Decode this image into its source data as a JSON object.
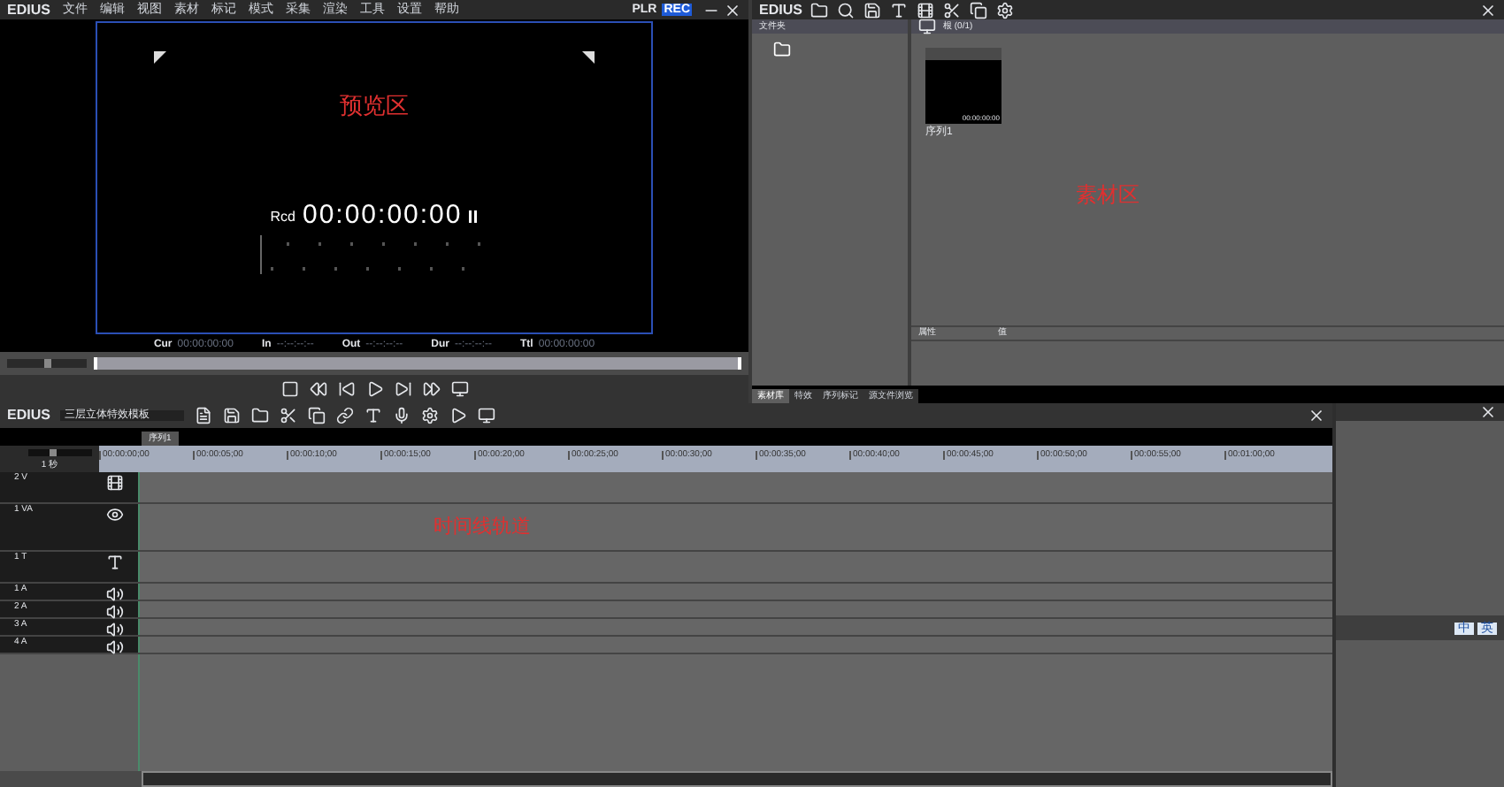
{
  "player": {
    "app_name": "EDIUS",
    "menu": [
      "文件",
      "编辑",
      "视图",
      "素材",
      "标记",
      "模式",
      "采集",
      "渲染",
      "工具",
      "设置",
      "帮助"
    ],
    "modes": [
      {
        "label": "PLR",
        "selected": false
      },
      {
        "label": "REC",
        "selected": true
      }
    ],
    "annotation": "预览区",
    "zoom": {
      "level": 0.5
    },
    "timecode_label": "Rcd",
    "timecode": "00:00:00:00",
    "readouts": [
      {
        "label": "Cur",
        "value": "00:00:00:00"
      },
      {
        "label": "In",
        "value": "--:--:--:--"
      },
      {
        "label": "Out",
        "value": "--:--:--:--"
      },
      {
        "label": "Dur",
        "value": "--:--:--:--"
      },
      {
        "label": "Ttl",
        "value": "00:00:00:00"
      }
    ]
  },
  "bin": {
    "app_name": "EDIUS",
    "folder_header": "文件夹",
    "clip_header": "根 (0/1)",
    "clip": {
      "timecode": "00:00:00:00",
      "name": "序列1"
    },
    "annotation": "素材区",
    "properties_columns": [
      "属性",
      "值"
    ],
    "tabs": [
      {
        "label": "素材库",
        "selected": true
      },
      {
        "label": "特效",
        "selected": false
      },
      {
        "label": "序列标记",
        "selected": false
      },
      {
        "label": "源文件浏览",
        "selected": false
      }
    ]
  },
  "timeline": {
    "app_name": "EDIUS",
    "project": "三层立体特效模板",
    "sequence_tab": "序列1",
    "scale": "1 秒",
    "zoom": {
      "level": 0.4
    },
    "ruler": [
      "00:00:00;00",
      "00:00:05;00",
      "00:00:10;00",
      "00:00:15;00",
      "00:00:20;00",
      "00:00:25;00",
      "00:00:30;00",
      "00:00:35;00",
      "00:00:40;00",
      "00:00:45;00",
      "00:00:50;00",
      "00:00:55;00",
      "00:01:00;00"
    ],
    "tracks": [
      {
        "name": "2 V",
        "kind": "video"
      },
      {
        "name": "1 VA",
        "kind": "videoaudio"
      },
      {
        "name": "1 T",
        "kind": "title"
      },
      {
        "name": "1 A",
        "kind": "audio"
      },
      {
        "name": "2 A",
        "kind": "audio"
      },
      {
        "name": "3 A",
        "kind": "audio"
      },
      {
        "name": "4 A",
        "kind": "audio"
      }
    ],
    "annotation": "时间线轨道"
  },
  "ime_bar": [
    "中",
    "英"
  ]
}
